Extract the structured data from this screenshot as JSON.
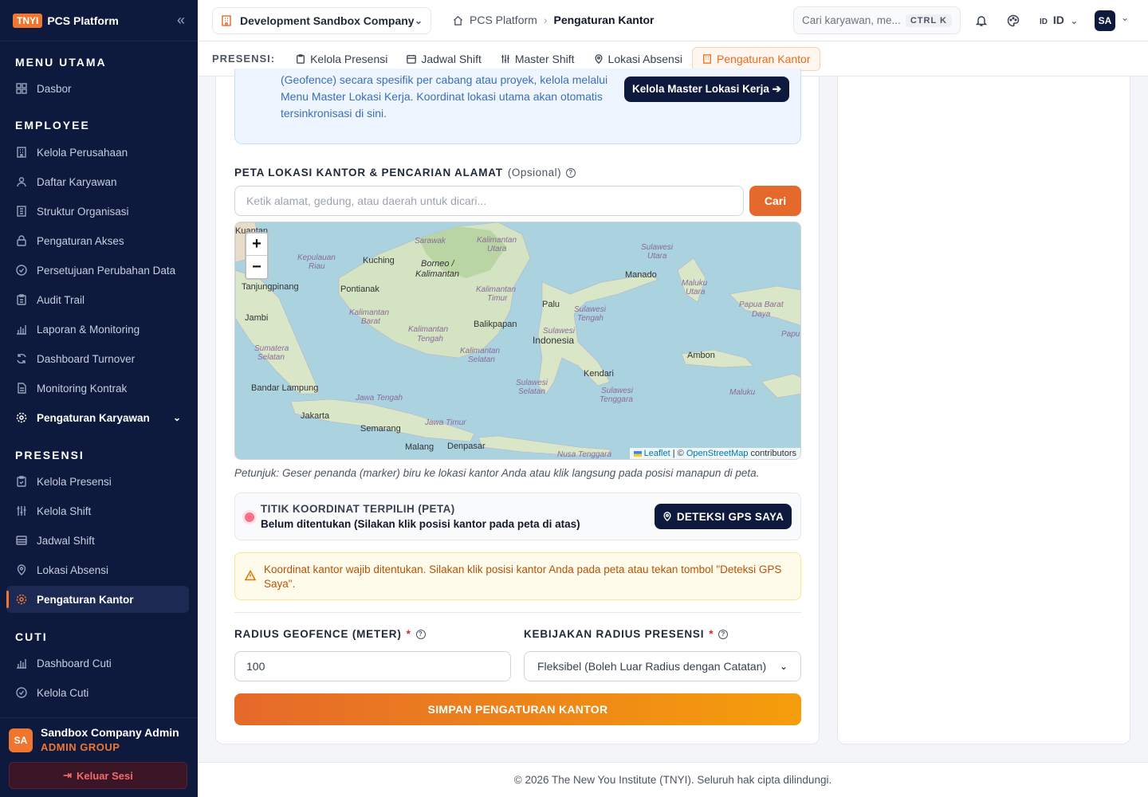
{
  "brand": {
    "tag": "TNYI",
    "name": "PCS Platform"
  },
  "sidebar": {
    "sections": [
      {
        "title": "MENU UTAMA"
      },
      {
        "title": "EMPLOYEE"
      },
      {
        "title": "PRESENSI"
      },
      {
        "title": "CUTI"
      }
    ],
    "items": [
      {
        "label": "Dasbor"
      },
      {
        "label": "Kelola Perusahaan"
      },
      {
        "label": "Daftar Karyawan"
      },
      {
        "label": "Struktur Organisasi"
      },
      {
        "label": "Pengaturan Akses"
      },
      {
        "label": "Persetujuan Perubahan Data"
      },
      {
        "label": "Audit Trail"
      },
      {
        "label": "Laporan & Monitoring"
      },
      {
        "label": "Dashboard Turnover"
      },
      {
        "label": "Monitoring Kontrak"
      },
      {
        "label": "Pengaturan Karyawan"
      },
      {
        "label": "Kelola Presensi"
      },
      {
        "label": "Kelola Shift"
      },
      {
        "label": "Jadwal Shift"
      },
      {
        "label": "Lokasi Absensi"
      },
      {
        "label": "Pengaturan Kantor"
      },
      {
        "label": "Dashboard Cuti"
      },
      {
        "label": "Kelola Cuti"
      }
    ],
    "user": {
      "initials": "SA",
      "name": "Sandbox Company Admin",
      "group": "ADMIN GROUP",
      "logout": "Keluar Sesi"
    }
  },
  "header": {
    "company": "Development Sandbox Company",
    "breadcrumb": {
      "root": "PCS Platform",
      "current": "Pengaturan Kantor"
    },
    "search": {
      "placeholder": "Cari karyawan, me...",
      "shortcut": "CTRL K"
    },
    "lang": "ID",
    "avatar": "SA"
  },
  "tabs": {
    "label": "PRESENSI:",
    "items": [
      {
        "label": "Kelola Presensi"
      },
      {
        "label": "Jadwal Shift"
      },
      {
        "label": "Master Shift"
      },
      {
        "label": "Lokasi Absensi"
      },
      {
        "label": "Pengaturan Kantor"
      }
    ]
  },
  "info": {
    "text": "(Geofence) secara spesifik per cabang atau proyek, kelola melalui Menu Master Lokasi Kerja. Koordinat lokasi utama akan otomatis tersinkronisasi di sini.",
    "button": "Kelola Master Lokasi Kerja ➔"
  },
  "map_section": {
    "title": "PETA LOKASI KANTOR & PENCARIAN ALAMAT",
    "optional": "(Opsional)",
    "search_placeholder": "Ketik alamat, gedung, atau daerah untuk dicari...",
    "search_button": "Cari",
    "zoom_in": "+",
    "zoom_out": "−",
    "attribution": {
      "leaflet": "Leaflet",
      "sep": " | © ",
      "osm": "OpenStreetMap",
      "suffix": " contributors"
    },
    "hint": "Petunjuk: Geser penanda (marker) biru ke lokasi kantor Anda atau klik langsung pada posisi manapun di peta."
  },
  "coordinate": {
    "title": "TITIK KOORDINAT TERPILIH (PETA)",
    "value": "Belum ditentukan (Silakan klik posisi kantor pada peta di atas)",
    "gps_button": "DETEKSI GPS SAYA"
  },
  "warning": "Koordinat kantor wajib ditentukan. Silakan klik posisi kantor Anda pada peta atau tekan tombol \"Deteksi GPS Saya\".",
  "radius": {
    "label": "RADIUS GEOFENCE (METER)",
    "value": "100"
  },
  "policy": {
    "label": "KEBIJAKAN RADIUS PRESENSI",
    "value": "Fleksibel (Boleh Luar Radius dengan Catatan)"
  },
  "save_button": "SIMPAN PENGATURAN KANTOR",
  "footer": "© 2026 The New You Institute (TNYI). Seluruh hak cipta dilindungi.",
  "map_labels": {
    "places": [
      "Kuantan",
      "Kuching",
      "Pontianak",
      "Tanjungpinang",
      "Jambi",
      "Bandar Lampung",
      "Jakarta",
      "Semarang",
      "Malang",
      "Denpasar",
      "Balikpapan",
      "Palu",
      "Manado",
      "Kendari",
      "Ambon",
      "Indonesia",
      "Borneo / Kalimantan"
    ],
    "provinces": [
      "Sarawak",
      "Kalimantan Utara",
      "Kepulauan Riau",
      "Kalimantan Timur",
      "Kalimantan Barat",
      "Kalimantan Tengah",
      "Kalimantan Selatan",
      "Sumatera Selatan",
      "Jawa Tengah",
      "Jawa Timur",
      "Nusa Tenggara",
      "Sulawesi Utara",
      "Sulawesi Tengah",
      "Sulawesi Selatan",
      "Sulawesi Tenggara",
      "Maluku Utara",
      "Maluku",
      "Papua Barat Daya",
      "Papu",
      "Sulawesi"
    ]
  },
  "colors": {
    "sidebar": "#0e1a3d",
    "accent": "#f0762f",
    "sea": "#aad3df",
    "land": "#d8e8c8"
  }
}
